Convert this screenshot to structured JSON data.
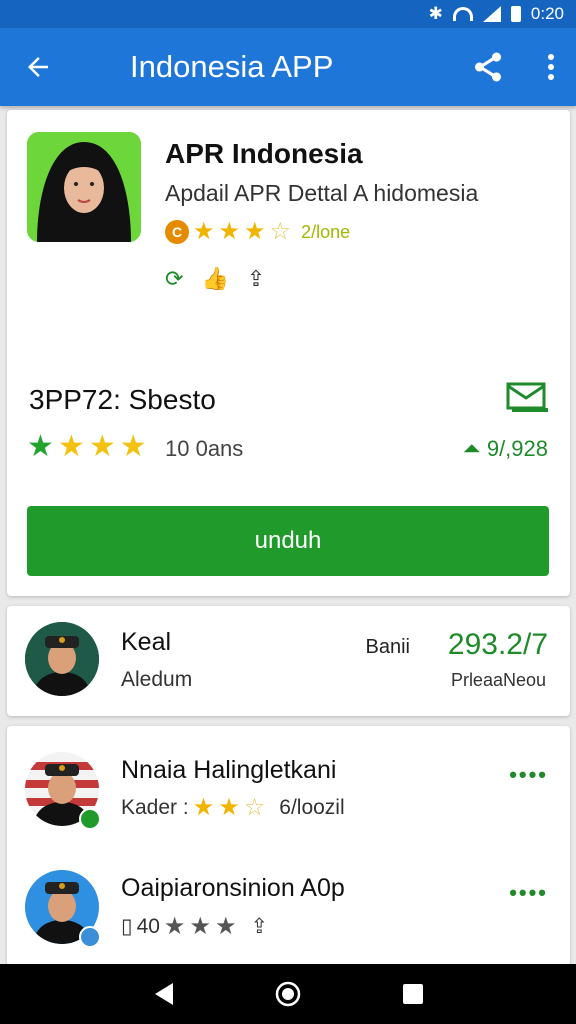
{
  "status_bar": {
    "time": "0:20",
    "icons": [
      "bluetooth-icon",
      "wifi-icon",
      "signal-icon",
      "battery-icon"
    ]
  },
  "app_bar": {
    "title": "Indonesia APP",
    "back_icon": "arrow-left-icon",
    "share_icon": "share-icon",
    "menu_icon": "more-vertical-icon"
  },
  "app_card": {
    "name": "APR Indonesia",
    "subtitle": "Apdail APR Dettal A hidomesia",
    "badge_text": "C",
    "rating_text": "2/lone",
    "meta_icons": [
      "refresh-icon",
      "thumb-icon",
      "share-box-icon"
    ],
    "section_title": "3PP72: Sbesto",
    "section_icon": "mail-box-icon",
    "downloads": "10 0ans",
    "size": "9/,928",
    "install_label": "unduh",
    "colors": {
      "accent": "#1e77d8",
      "install": "#1f9a2b",
      "star": "#f1b400"
    }
  },
  "seller_card": {
    "name": "Keal",
    "subtitle": "Aledum",
    "price_label": "Banii",
    "price_value": "293.2/7",
    "price_sub": "PrleaaNeou"
  },
  "list": [
    {
      "title": "Nnaia Halingletkani",
      "sub_prefix": "Kader :",
      "sub_suffix": "6/loozil",
      "stars": 3
    },
    {
      "title": "Oaipiaronsinion A0p",
      "sub_prefix": "",
      "sub_suffix": "",
      "stars": 3
    }
  ],
  "nav": {
    "back": "nav-back-icon",
    "home": "nav-home-icon",
    "recents": "nav-recents-icon"
  }
}
